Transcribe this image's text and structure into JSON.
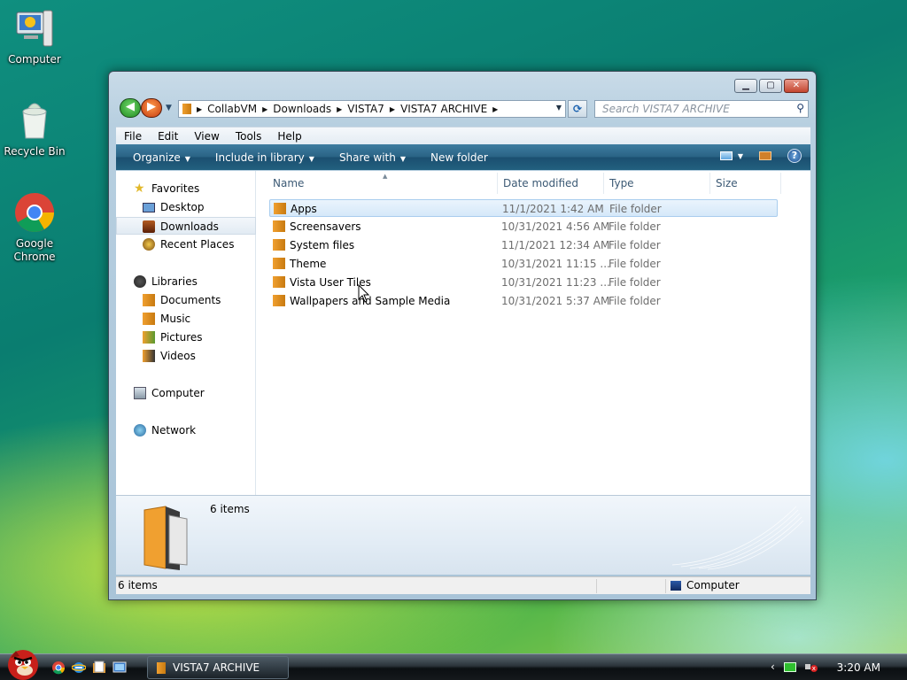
{
  "desktop": {
    "icons": [
      {
        "label": "Computer"
      },
      {
        "label": "Recycle Bin"
      },
      {
        "label": "Google Chrome"
      }
    ]
  },
  "window": {
    "address": {
      "crumbs": [
        "CollabVM",
        "Downloads",
        "VISTA7",
        "VISTA7 ARCHIVE"
      ]
    },
    "search": {
      "placeholder": "Search VISTA7 ARCHIVE"
    },
    "menu": [
      "File",
      "Edit",
      "View",
      "Tools",
      "Help"
    ],
    "commands": {
      "organize": "Organize",
      "include": "Include in library",
      "share": "Share with",
      "new_folder": "New folder"
    },
    "nav": {
      "favorites": "Favorites",
      "desktop": "Desktop",
      "downloads": "Downloads",
      "recent": "Recent Places",
      "libraries": "Libraries",
      "documents": "Documents",
      "music": "Music",
      "pictures": "Pictures",
      "videos": "Videos",
      "computer": "Computer",
      "network": "Network"
    },
    "columns": {
      "name": "Name",
      "date": "Date modified",
      "type": "Type",
      "size": "Size"
    },
    "files": [
      {
        "name": "Apps",
        "date": "11/1/2021 1:42 AM",
        "type": "File folder"
      },
      {
        "name": "Screensavers",
        "date": "10/31/2021 4:56 AM",
        "type": "File folder"
      },
      {
        "name": "System files",
        "date": "11/1/2021 12:34 AM",
        "type": "File folder"
      },
      {
        "name": "Theme",
        "date": "10/31/2021 11:15 ...",
        "type": "File folder"
      },
      {
        "name": "Vista User Tiles",
        "date": "10/31/2021 11:23 ...",
        "type": "File folder"
      },
      {
        "name": "Wallpapers and Sample Media",
        "date": "10/31/2021 5:37 AM",
        "type": "File folder"
      }
    ],
    "details_count": "6 items",
    "status_count": "6 items",
    "status_location": "Computer"
  },
  "taskbar": {
    "task_label": "VISTA7 ARCHIVE",
    "clock": "3:20 AM"
  },
  "colors": {
    "command_bar": "#2a6385",
    "selection": "#d5e8f9",
    "folder": "#f0a030"
  }
}
